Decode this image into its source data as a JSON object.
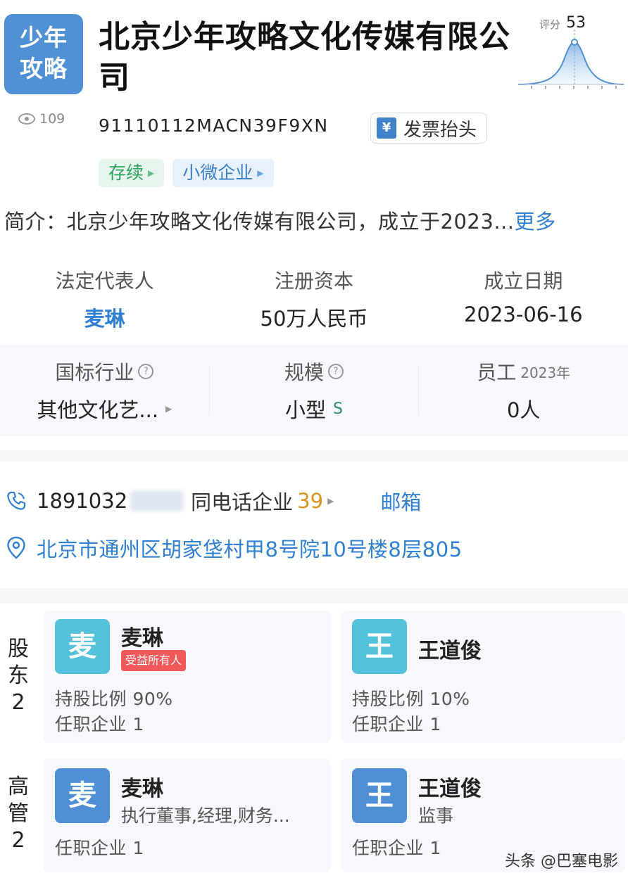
{
  "header": {
    "logo_line1": "少年",
    "logo_line2": "攻略",
    "company_name": "北京少年攻略文化传媒有限公司",
    "view_count": "109",
    "credit_code": "91110112MACN39F9XN",
    "invoice_icon": "¥",
    "invoice_label": "发票抬头",
    "score_label": "评分",
    "score_value": "53"
  },
  "tags": [
    {
      "label": "存续",
      "color": "#2ca35a"
    },
    {
      "label": "小微企业",
      "color": "#3a7fc6"
    }
  ],
  "intro": {
    "prefix": "简介：",
    "text": "北京少年攻略文化传媒有限公司，成立于2023...",
    "more": "更多"
  },
  "basic_info": {
    "legal_rep_label": "法定代表人",
    "legal_rep_value": "麦琳",
    "capital_label": "注册资本",
    "capital_value": "50万人民币",
    "founded_label": "成立日期",
    "founded_value": "2023-06-16",
    "industry_label": "国标行业",
    "industry_value": "其他文化艺...",
    "scale_label": "规模",
    "scale_value": "小型",
    "scale_badge": "S",
    "staff_label": "员工",
    "staff_year": "2023年",
    "staff_value": "0人"
  },
  "contact": {
    "phone_visible": "1891032",
    "same_phone_label": "同电话企业",
    "same_phone_count": "39",
    "email_label": "邮箱",
    "address": "北京市通州区胡家垡村甲8号院10号楼8层805"
  },
  "shareholders": {
    "label_line1": "股",
    "label_line2": "东",
    "count": "2",
    "items": [
      {
        "avatar": "麦",
        "name": "麦琳",
        "badge": "受益所有人",
        "ratio": "持股比例 90%",
        "jobs": "任职企业 1"
      },
      {
        "avatar": "王",
        "name": "王道俊",
        "ratio": "持股比例 10%",
        "jobs": "任职企业 1"
      }
    ]
  },
  "executives": {
    "label_line1": "高",
    "label_line2": "管",
    "count": "2",
    "items": [
      {
        "avatar": "麦",
        "name": "麦琳",
        "role": "执行董事,经理,财务...",
        "jobs": "任职企业 1"
      },
      {
        "avatar": "王",
        "name": "王道俊",
        "role": "监事",
        "jobs": "任职企业 1"
      }
    ]
  },
  "watermark": "头条 @巴塞电影"
}
